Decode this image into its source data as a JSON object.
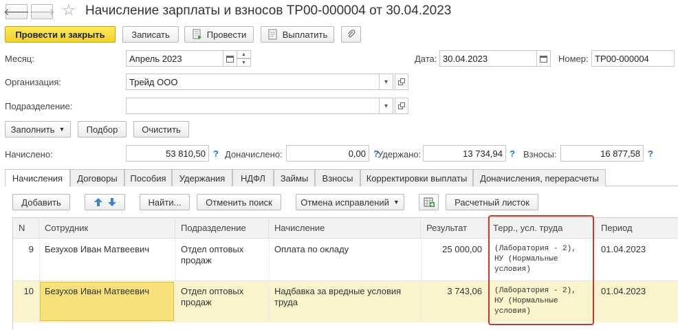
{
  "window": {
    "title": "Начисление зарплаты и взносов ТР00-000004 от 30.04.2023",
    "back_glyph": "🡐",
    "forward_glyph": "🡒",
    "star_glyph": "☆"
  },
  "toolbar": {
    "post_close": "Провести и закрыть",
    "save": "Записать",
    "post": "Провести",
    "pay": "Выплатить"
  },
  "form": {
    "month_label": "Месяц:",
    "month_value": "Апрель 2023",
    "date_label": "Дата:",
    "date_value": "30.04.2023",
    "number_label": "Номер:",
    "number_value": "ТР00-000004",
    "org_label": "Организация:",
    "org_value": "Трейд ООО",
    "dept_label": "Подразделение:",
    "dept_value": ""
  },
  "actions": {
    "fill": "Заполнить",
    "select": "Подбор",
    "clear": "Очистить"
  },
  "totals": {
    "accrued_label": "Начислено:",
    "accrued_value": "53 810,50",
    "extra_label": "Доначислено:",
    "extra_value": "0,00",
    "withheld_label": "Удержано:",
    "withheld_value": "13 734,94",
    "contrib_label": "Взносы:",
    "contrib_value": "16 877,58",
    "help": "?"
  },
  "tabs": [
    "Начисления",
    "Договоры",
    "Пособия",
    "Удержания",
    "НДФЛ",
    "Займы",
    "Взносы",
    "Корректировки выплаты",
    "Доначисления, перерасчеты"
  ],
  "table_toolbar": {
    "add": "Добавить",
    "find": "Найти...",
    "cancel_search": "Отменить поиск",
    "cancel_fix": "Отмена исправлений",
    "payslip": "Расчетный листок"
  },
  "table": {
    "headers": [
      "N",
      "Сотрудник",
      "Подразделение",
      "Начисление",
      "Результат",
      "Терр., усл. труда",
      "Период"
    ],
    "rows": [
      {
        "n": "9",
        "employee": "Безухов Иван Матвеевич",
        "dept": "Отдел оптовых продаж",
        "accrual": "Оплата по окладу",
        "result": "25 000,00",
        "terr": "(Лаборатория - 2), НУ (Нормальные условия)",
        "period": "01.04.2023"
      },
      {
        "n": "10",
        "employee": "Безухов Иван Матвеевич",
        "dept": "Отдел оптовых продаж",
        "accrual": "Надбавка за вредные условия труда",
        "result": "3 743,06",
        "terr": "(Лаборатория - 2), НУ (Нормальные условия)",
        "period": "01.04.2023"
      }
    ]
  },
  "colors": {
    "primary_button": "#f5d83a",
    "selected_row": "#fbf3cc",
    "selected_cell": "#f7e17a",
    "highlight_frame": "#c0392b",
    "help_blue": "#1e78c8"
  }
}
